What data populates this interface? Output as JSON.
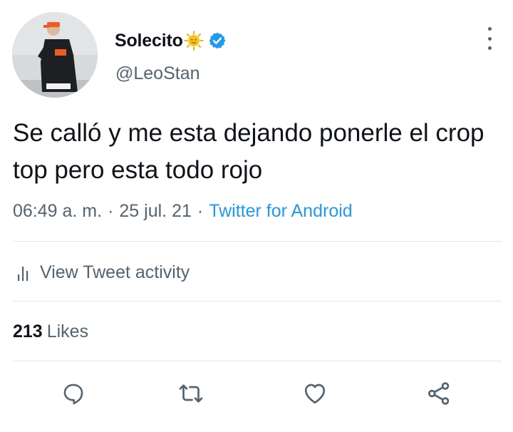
{
  "tweet": {
    "display_name": "Solecito",
    "name_emoji": "sun-with-face-emoji",
    "verified": true,
    "handle": "@LeoStan",
    "text": "Se calló y me esta dejando ponerle el crop top pero esta todo rojo",
    "time": "06:49 a. m.",
    "separator": "·",
    "date": "25 jul. 21",
    "source": "Twitter for Android"
  },
  "activity": {
    "label": "View Tweet activity",
    "icon": "analytics-icon"
  },
  "stats": {
    "likes_count": "213",
    "likes_label": "Likes"
  },
  "actions": [
    "reply-icon",
    "retweet-icon",
    "like-icon",
    "share-icon"
  ],
  "colors": {
    "accent": "#1d9bf0",
    "text_primary": "#0f1419",
    "text_secondary": "#536471",
    "divider": "#e3e6e8",
    "emoji_sun": "#f7c21e"
  }
}
